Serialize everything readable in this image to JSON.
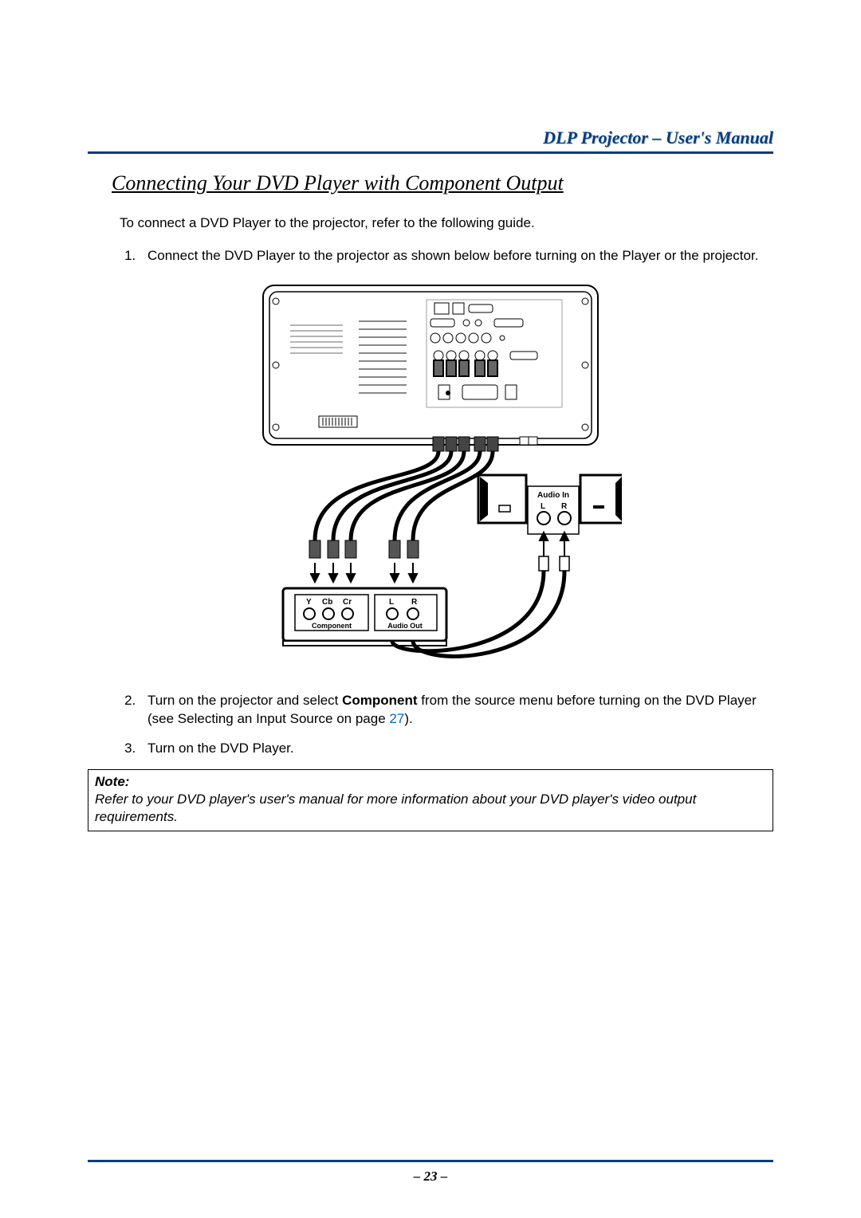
{
  "header": {
    "title": "DLP Projector – User's Manual"
  },
  "section_title": "Connecting Your DVD Player with Component Output",
  "intro": "To connect a DVD Player to the projector, refer to the following guide.",
  "steps": {
    "s1": "Connect the DVD Player to the projector as shown below before turning on the Player or the projector.",
    "s2_a": "Turn on the projector and select ",
    "s2_bold": "Component",
    "s2_b": " from the source menu before turning on the DVD Player (see Selecting an Input Source on page ",
    "s2_link": "27",
    "s2_c": ").",
    "s3": "Turn on the DVD Player."
  },
  "diagram": {
    "audio_in": "Audio In",
    "L": "L",
    "R": "R",
    "Y": "Y",
    "Cb": "Cb",
    "Cr": "Cr",
    "component": "Component",
    "audio_out": "Audio Out"
  },
  "note": {
    "label": "Note:",
    "text": "Refer to your DVD player's user's manual for more information about your DVD player's video output requirements."
  },
  "page_number": "– 23 –"
}
